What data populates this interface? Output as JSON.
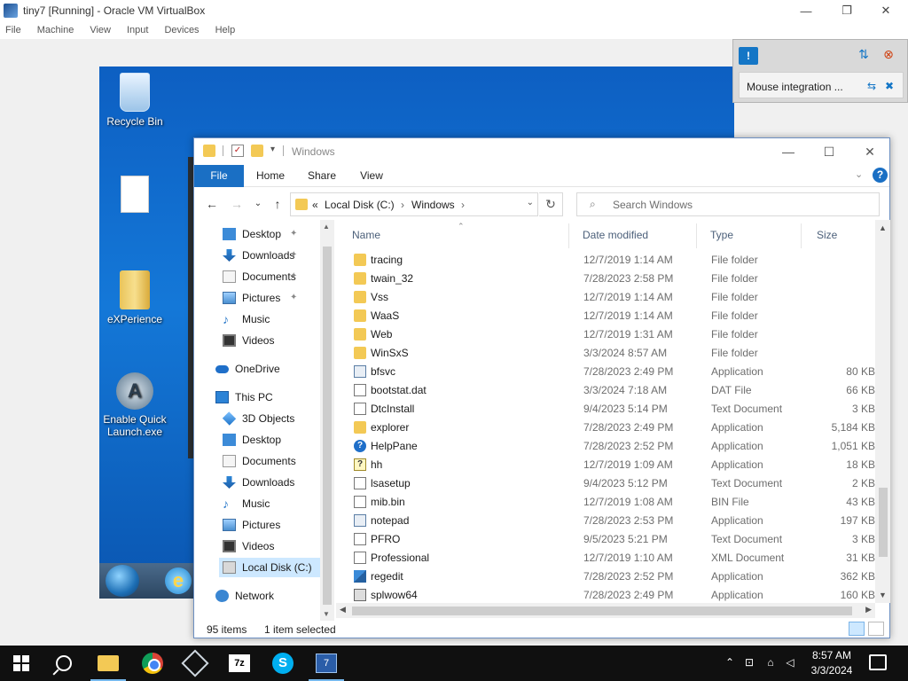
{
  "host": {
    "title": "tiny7 [Running] - Oracle VM VirtualBox",
    "menu": [
      "File",
      "Machine",
      "View",
      "Input",
      "Devices",
      "Help"
    ],
    "controls": {
      "minimize": "—",
      "maximize": "❐",
      "close": "✕"
    }
  },
  "vbox_overlay": {
    "message": "Mouse integration ...",
    "icons": [
      "notification-icon",
      "host-key-icon",
      "capture-icon",
      "pin-icon",
      "close-icon"
    ]
  },
  "guest_desktop": {
    "icons": [
      {
        "label": "Recycle Bin",
        "icon": "recycle-bin-icon"
      },
      {
        "label": "",
        "icon": "file-icon"
      },
      {
        "label": "eXPerience",
        "icon": "folder-icon"
      },
      {
        "label": "Enable Quick Launch.exe",
        "icon": "launch-icon"
      }
    ]
  },
  "explorer": {
    "title": "Windows",
    "quick_access": {
      "dropdown": "▾"
    },
    "controls": {
      "minimize": "—",
      "maximize": "☐",
      "close": "✕"
    },
    "ribbon": {
      "tabs": [
        "File",
        "Home",
        "Share",
        "View"
      ],
      "expand": "⌄",
      "help": "?"
    },
    "nav": {
      "back": "←",
      "forward": "→",
      "recent": "⌄",
      "up": "↑",
      "refresh": "↻"
    },
    "address": {
      "prefix": "«",
      "segments": [
        "Local Disk (C:)",
        "Windows"
      ],
      "sep": "›",
      "dropdown": "⌄"
    },
    "search": {
      "placeholder": "Search Windows",
      "icon": "⌕"
    },
    "nav_pane": [
      {
        "label": "Desktop",
        "icon": "desktop-icon",
        "pinned": true,
        "indent": 1
      },
      {
        "label": "Downloads",
        "icon": "downloads-icon",
        "pinned": true,
        "indent": 1
      },
      {
        "label": "Documents",
        "icon": "documents-icon",
        "pinned": true,
        "indent": 1
      },
      {
        "label": "Pictures",
        "icon": "pictures-icon",
        "pinned": true,
        "indent": 1
      },
      {
        "label": "Music",
        "icon": "music-icon",
        "pinned": false,
        "indent": 1
      },
      {
        "label": "Videos",
        "icon": "videos-icon",
        "pinned": false,
        "indent": 1
      },
      {
        "label": "OneDrive",
        "icon": "onedrive-icon",
        "pinned": false,
        "indent": 0
      },
      {
        "label": "This PC",
        "icon": "this-pc-icon",
        "pinned": false,
        "indent": 0
      },
      {
        "label": "3D Objects",
        "icon": "3d-objects-icon",
        "pinned": false,
        "indent": 1
      },
      {
        "label": "Desktop",
        "icon": "desktop-icon",
        "pinned": false,
        "indent": 1
      },
      {
        "label": "Documents",
        "icon": "documents-icon",
        "pinned": false,
        "indent": 1
      },
      {
        "label": "Downloads",
        "icon": "downloads-icon",
        "pinned": false,
        "indent": 1
      },
      {
        "label": "Music",
        "icon": "music-icon",
        "pinned": false,
        "indent": 1
      },
      {
        "label": "Pictures",
        "icon": "pictures-icon",
        "pinned": false,
        "indent": 1
      },
      {
        "label": "Videos",
        "icon": "videos-icon",
        "pinned": false,
        "indent": 1
      },
      {
        "label": "Local Disk (C:)",
        "icon": "local-disk-icon",
        "pinned": false,
        "indent": 1,
        "selected": true
      },
      {
        "label": "Network",
        "icon": "network-icon",
        "pinned": false,
        "indent": 0
      }
    ],
    "columns": [
      "Name",
      "Date modified",
      "Type",
      "Size"
    ],
    "files": [
      {
        "name": "tracing",
        "date": "12/7/2019 1:14 AM",
        "type": "File folder",
        "size": "",
        "icon": "folder"
      },
      {
        "name": "twain_32",
        "date": "7/28/2023 2:58 PM",
        "type": "File folder",
        "size": "",
        "icon": "folder"
      },
      {
        "name": "Vss",
        "date": "12/7/2019 1:14 AM",
        "type": "File folder",
        "size": "",
        "icon": "folder"
      },
      {
        "name": "WaaS",
        "date": "12/7/2019 1:14 AM",
        "type": "File folder",
        "size": "",
        "icon": "folder"
      },
      {
        "name": "Web",
        "date": "12/7/2019 1:31 AM",
        "type": "File folder",
        "size": "",
        "icon": "folder"
      },
      {
        "name": "WinSxS",
        "date": "3/3/2024 8:57 AM",
        "type": "File folder",
        "size": "",
        "icon": "folder"
      },
      {
        "name": "bfsvc",
        "date": "7/28/2023 2:49 PM",
        "type": "Application",
        "size": "80 KB",
        "icon": "app"
      },
      {
        "name": "bootstat.dat",
        "date": "3/3/2024 7:18 AM",
        "type": "DAT File",
        "size": "66 KB",
        "icon": "dat"
      },
      {
        "name": "DtcInstall",
        "date": "9/4/2023 5:14 PM",
        "type": "Text Document",
        "size": "3 KB",
        "icon": "txt"
      },
      {
        "name": "explorer",
        "date": "7/28/2023 2:49 PM",
        "type": "Application",
        "size": "5,184 KB",
        "icon": "explorer"
      },
      {
        "name": "HelpPane",
        "date": "7/28/2023 2:52 PM",
        "type": "Application",
        "size": "1,051 KB",
        "icon": "help"
      },
      {
        "name": "hh",
        "date": "12/7/2019 1:09 AM",
        "type": "Application",
        "size": "18 KB",
        "icon": "hh"
      },
      {
        "name": "lsasetup",
        "date": "9/4/2023 5:12 PM",
        "type": "Text Document",
        "size": "2 KB",
        "icon": "txt"
      },
      {
        "name": "mib.bin",
        "date": "12/7/2019 1:08 AM",
        "type": "BIN File",
        "size": "43 KB",
        "icon": "dat"
      },
      {
        "name": "notepad",
        "date": "7/28/2023 2:53 PM",
        "type": "Application",
        "size": "197 KB",
        "icon": "app"
      },
      {
        "name": "PFRO",
        "date": "9/5/2023 5:21 PM",
        "type": "Text Document",
        "size": "3 KB",
        "icon": "txt"
      },
      {
        "name": "Professional",
        "date": "12/7/2019 1:10 AM",
        "type": "XML Document",
        "size": "31 KB",
        "icon": "xml"
      },
      {
        "name": "regedit",
        "date": "7/28/2023 2:52 PM",
        "type": "Application",
        "size": "362 KB",
        "icon": "reg"
      },
      {
        "name": "splwow64",
        "date": "7/28/2023 2:49 PM",
        "type": "Application",
        "size": "160 KB",
        "icon": "print"
      }
    ],
    "status": {
      "items": "95 items",
      "selected": "1 item selected"
    }
  },
  "host_taskbar": {
    "apps": [
      "start-icon",
      "search-icon",
      "file-explorer-icon",
      "chrome-icon",
      "virtualbox-icon",
      "7zip-icon",
      "skype-icon",
      "vm-window-icon"
    ],
    "labels": {
      "sevenzip": "7z",
      "skype": "S",
      "vm": "7"
    },
    "tray": {
      "chevron": "⌃",
      "clock_time": "8:57 AM",
      "clock_date": "3/3/2024"
    }
  },
  "colors": {
    "accent": "#1a6fc4",
    "selection": "#cde8ff",
    "win7_desktop": "#1478d8"
  }
}
